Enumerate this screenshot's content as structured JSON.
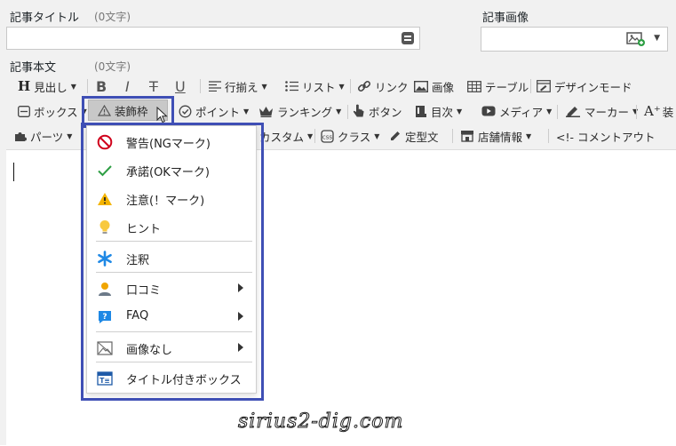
{
  "fields": {
    "title_label": "記事タイトル",
    "title_count": "(0文字)",
    "image_label": "記事画像",
    "body_label": "記事本文",
    "body_count": "(0文字)"
  },
  "toolbar": {
    "row1": {
      "heading": "見出し",
      "bold": "B",
      "italic": "I",
      "strike": "T",
      "underline": "U",
      "align": "行揃え",
      "list": "リスト",
      "link": "リンク",
      "image": "画像",
      "table": "テーブル",
      "design_mode": "デザインモード"
    },
    "row2": {
      "box": "ボックス",
      "deco_frame": "装飾枠",
      "point": "ポイント",
      "ranking": "ランキング",
      "button": "ボタン",
      "toc": "目次",
      "media": "メディア",
      "marker": "マーカー",
      "decoration": "装"
    },
    "row3": {
      "parts": "パーツ",
      "custom": "カスタム",
      "class": "クラス",
      "template": "定型文",
      "store_info": "店舗情報",
      "comment_out": "<!- コメントアウト"
    }
  },
  "dropdown": {
    "items": [
      {
        "label": "警告(NGマーク)",
        "icon": "prohibited-icon"
      },
      {
        "label": "承諾(OKマーク)",
        "icon": "checkmark-icon"
      },
      {
        "label": "注意(！マーク)",
        "icon": "warning-icon"
      },
      {
        "label": "ヒント",
        "icon": "lightbulb-icon"
      },
      {
        "label": "注釈",
        "icon": "asterisk-icon"
      },
      {
        "label": "口コミ",
        "icon": "person-icon"
      },
      {
        "label": "FAQ",
        "icon": "question-icon"
      },
      {
        "label": "画像なし",
        "icon": "no-image-icon"
      },
      {
        "label": "タイトル付きボックス",
        "icon": "titled-box-icon"
      }
    ]
  },
  "colors": {
    "highlight_border": "#3f4fb5",
    "ng_red": "#d0021b",
    "ok_green": "#2e9e44",
    "warning_yellow": "#f4b400",
    "asterisk_blue": "#1e88e5"
  },
  "watermark": "sirius2-dig.com"
}
